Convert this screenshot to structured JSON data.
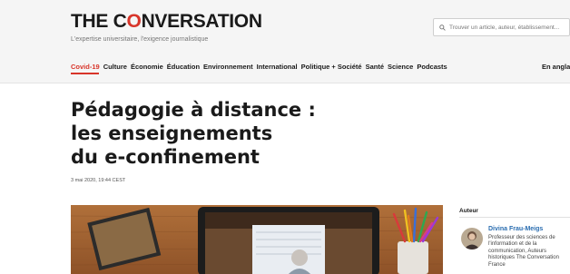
{
  "header": {
    "logo_before": "THE C",
    "logo_o": "O",
    "logo_after": "NVERSATION",
    "tagline": "L'expertise universitaire, l'exigence journalistique",
    "search_placeholder": "Trouver un article, auteur, établissement..."
  },
  "nav": {
    "items": [
      {
        "label": "Covid-19",
        "active": true
      },
      {
        "label": "Culture"
      },
      {
        "label": "Économie"
      },
      {
        "label": "Éducation"
      },
      {
        "label": "Environnement"
      },
      {
        "label": "International"
      },
      {
        "label": "Politique + Société"
      },
      {
        "label": "Santé"
      },
      {
        "label": "Science"
      },
      {
        "label": "Podcasts"
      }
    ],
    "language_link": "En angla"
  },
  "article": {
    "title_line1": "Pédagogie à distance :",
    "title_line2": "les enseignements",
    "title_line3": "du e-confinement",
    "date": "3 mai 2020, 19:44 CEST"
  },
  "author_box": {
    "label": "Auteur",
    "name": "Divina Frau-Meigs",
    "bio": "Professeur des sciences de l'information et de la communication, Auteurs historiques The Conversation France"
  },
  "colors": {
    "brand_red": "#d8352a",
    "link_blue": "#2a6db0",
    "header_bg": "#f5f5f5"
  },
  "icons": {
    "search": "search-icon"
  }
}
